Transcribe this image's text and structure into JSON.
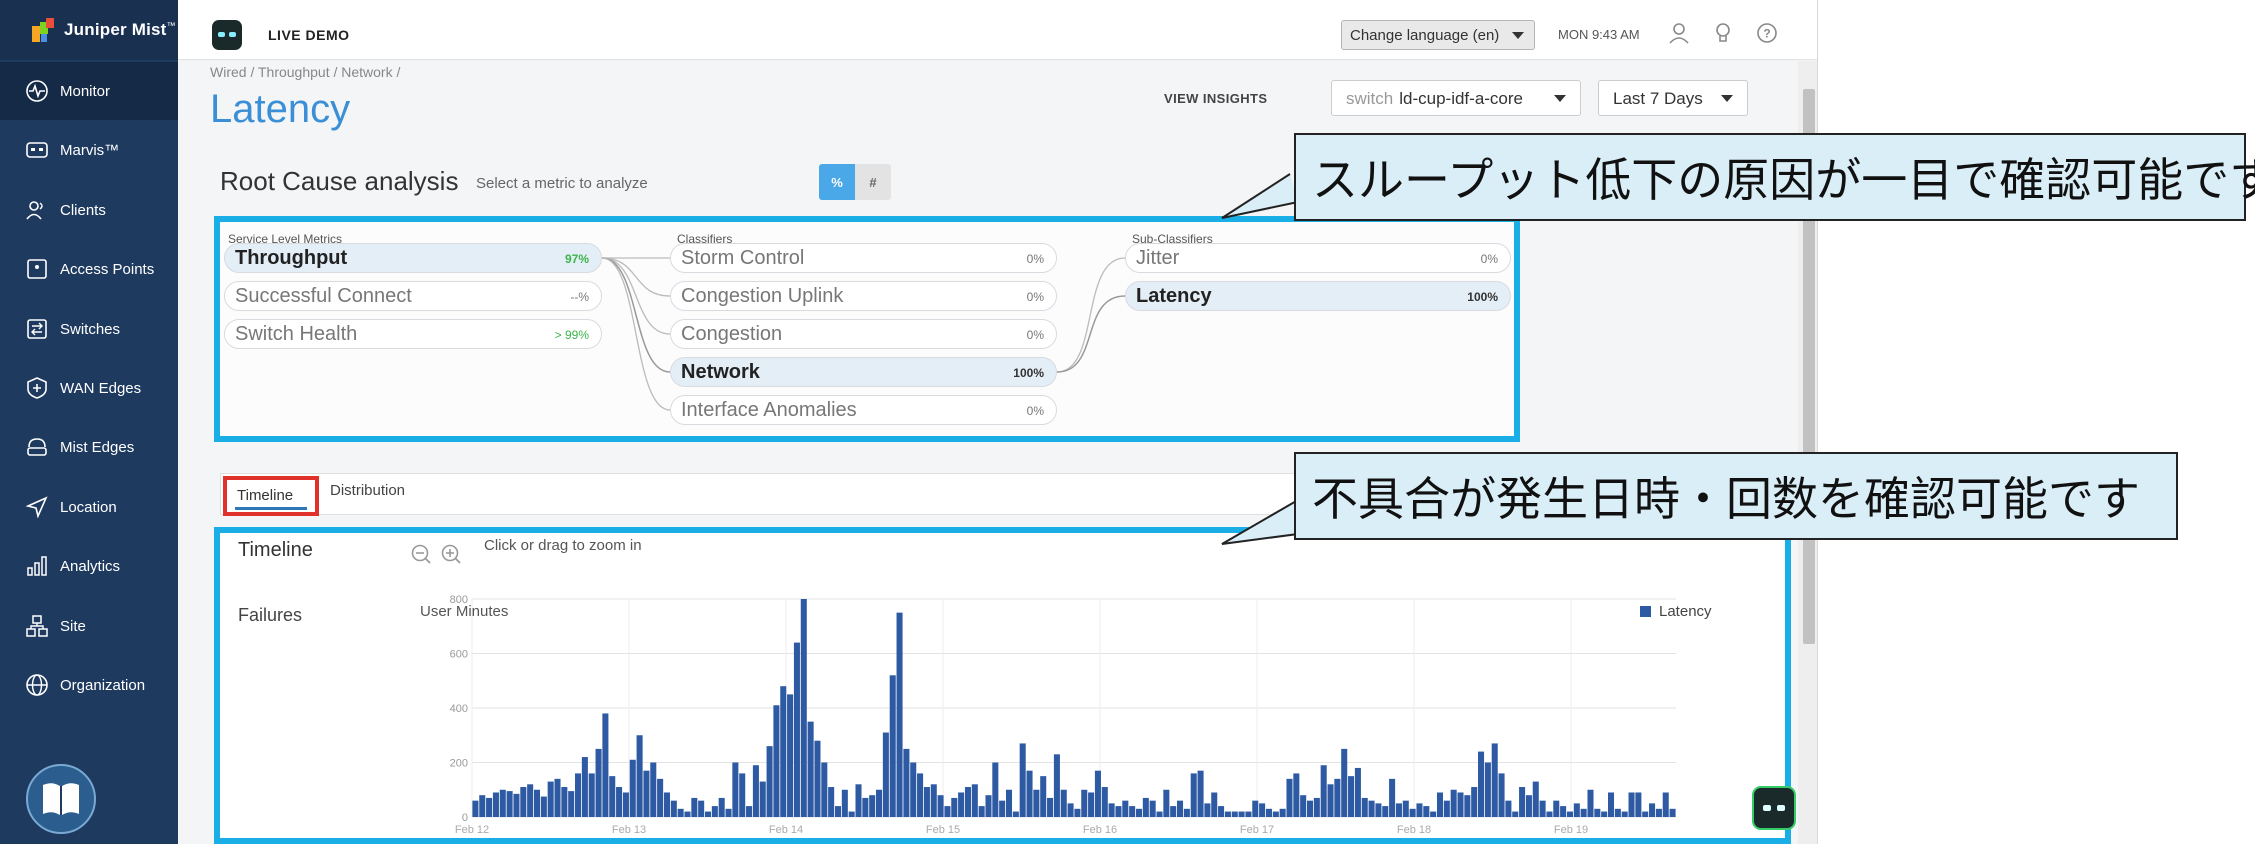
{
  "brand": {
    "name": "Juniper Mist",
    "tm": "™"
  },
  "topbar": {
    "mode": "LIVE DEMO",
    "language": "Change language (en)",
    "clock": "MON 9:43 AM"
  },
  "sidebar": {
    "items": [
      {
        "label": "Monitor",
        "icon": "monitor-icon"
      },
      {
        "label": "Marvis™",
        "icon": "marvis-icon"
      },
      {
        "label": "Clients",
        "icon": "clients-icon"
      },
      {
        "label": "Access Points",
        "icon": "access-point-icon"
      },
      {
        "label": "Switches",
        "icon": "switch-icon"
      },
      {
        "label": "WAN Edges",
        "icon": "wan-edge-icon"
      },
      {
        "label": "Mist Edges",
        "icon": "mist-edge-icon"
      },
      {
        "label": "Location",
        "icon": "location-icon"
      },
      {
        "label": "Analytics",
        "icon": "analytics-icon"
      },
      {
        "label": "Site",
        "icon": "site-icon"
      },
      {
        "label": "Organization",
        "icon": "organization-icon"
      }
    ]
  },
  "page": {
    "breadcrumb": "Wired / Throughput / Network /",
    "title": "Latency",
    "view_insights": "VIEW INSIGHTS",
    "switch_prefix": "switch",
    "switch_value": "ld-cup-idf-a-core",
    "range": "Last 7 Days"
  },
  "rca": {
    "title": "Root Cause analysis",
    "subtitle": "Select a metric to analyze",
    "pct_label": "%",
    "num_label": "#",
    "col_slm": "Service Level Metrics",
    "col_classifiers": "Classifiers",
    "col_sub": "Sub-Classifiers",
    "slm": [
      {
        "label": "Throughput",
        "value": "97%"
      },
      {
        "label": "Successful Connect",
        "value": "--%"
      },
      {
        "label": "Switch Health",
        "value": "> 99%"
      }
    ],
    "classifiers": [
      {
        "label": "Storm Control",
        "value": "0%"
      },
      {
        "label": "Congestion Uplink",
        "value": "0%"
      },
      {
        "label": "Congestion",
        "value": "0%"
      },
      {
        "label": "Network",
        "value": "100%"
      },
      {
        "label": "Interface Anomalies",
        "value": "0%"
      }
    ],
    "sub": [
      {
        "label": "Jitter",
        "value": "0%"
      },
      {
        "label": "Latency",
        "value": "100%"
      }
    ]
  },
  "tabs": {
    "timeline": "Timeline",
    "distribution": "Distribution"
  },
  "timeline": {
    "title": "Timeline",
    "hint": "Click or drag to zoom in",
    "failures": "Failures"
  },
  "callouts": {
    "top": "スループット低下の原因が一目で確認可能です",
    "bottom": "不具合が発生日時・回数を確認可能です"
  },
  "colors": {
    "accent": "#3a8fd6",
    "highlight": "#19aee6",
    "bar": "#2d5aa3",
    "sidebar": "#1e3a5f"
  },
  "chart_data": {
    "type": "bar",
    "ylabel": "User Minutes",
    "legend": [
      "Latency"
    ],
    "ylim": [
      0,
      800
    ],
    "yticks": [
      0,
      200,
      400,
      600,
      800
    ],
    "xticks": [
      "Feb 12",
      "Feb 13",
      "Feb 14",
      "Feb 15",
      "Feb 16",
      "Feb 17",
      "Feb 18",
      "Feb 19"
    ],
    "series": [
      {
        "name": "Latency",
        "values": [
          60,
          80,
          70,
          90,
          100,
          95,
          85,
          110,
          120,
          100,
          75,
          130,
          140,
          110,
          95,
          160,
          220,
          160,
          250,
          380,
          150,
          110,
          90,
          210,
          300,
          170,
          200,
          140,
          90,
          60,
          30,
          20,
          70,
          60,
          20,
          40,
          70,
          30,
          200,
          160,
          40,
          190,
          130,
          260,
          410,
          480,
          450,
          640,
          800,
          350,
          280,
          200,
          110,
          40,
          100,
          20,
          120,
          70,
          80,
          100,
          310,
          520,
          750,
          250,
          200,
          160,
          110,
          120,
          80,
          40,
          70,
          90,
          110,
          120,
          40,
          80,
          200,
          60,
          100,
          20,
          270,
          170,
          100,
          150,
          70,
          230,
          100,
          50,
          30,
          100,
          90,
          170,
          110,
          50,
          40,
          60,
          40,
          30,
          70,
          60,
          20,
          100,
          40,
          60,
          30,
          160,
          170,
          50,
          90,
          40,
          20,
          20,
          20,
          20,
          60,
          50,
          30,
          20,
          30,
          140,
          160,
          80,
          60,
          70,
          190,
          120,
          140,
          250,
          150,
          180,
          70,
          60,
          50,
          40,
          140,
          50,
          60,
          30,
          50,
          40,
          20,
          90,
          60,
          100,
          90,
          80,
          110,
          240,
          200,
          270,
          160,
          60,
          20,
          110,
          80,
          130,
          60,
          20,
          60,
          40,
          20,
          50,
          30,
          100,
          30,
          20,
          90,
          30,
          20,
          90,
          90,
          20,
          50,
          30,
          90,
          30
        ]
      }
    ]
  }
}
